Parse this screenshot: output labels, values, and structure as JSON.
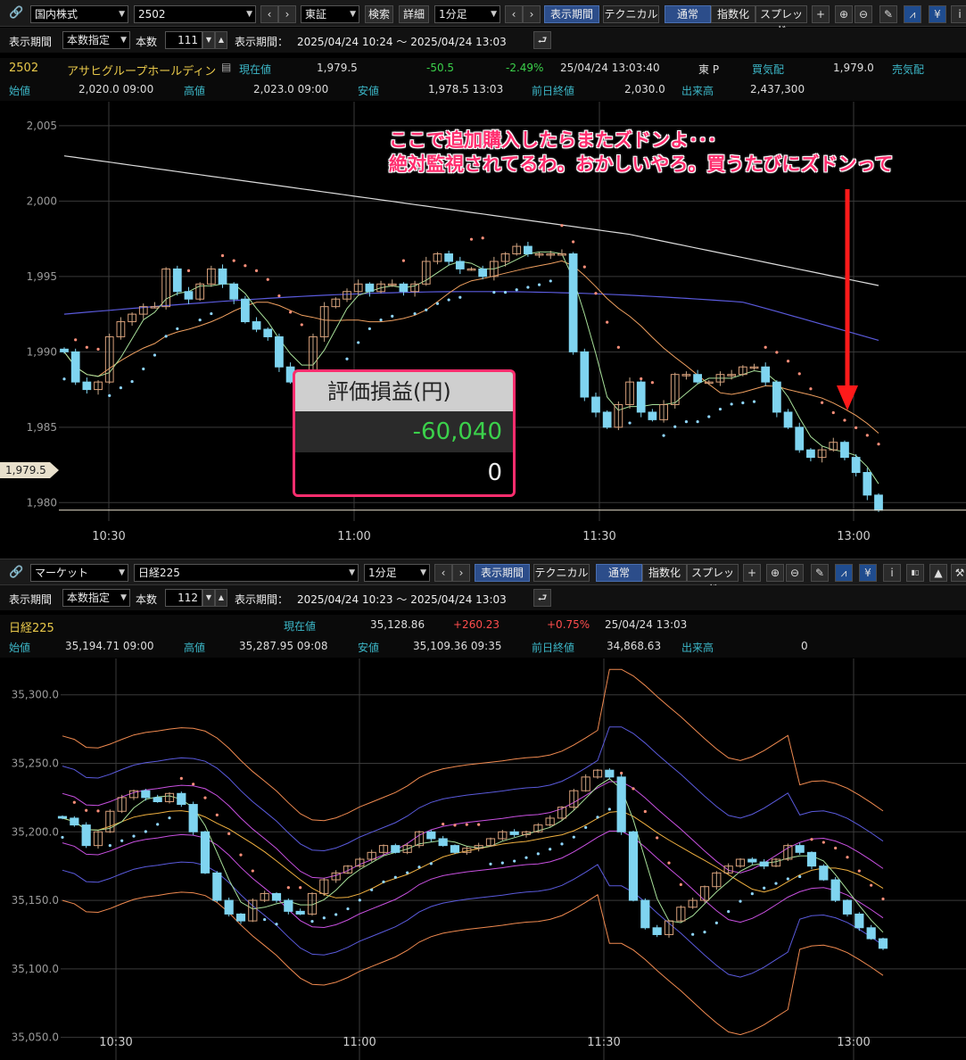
{
  "top": {
    "toolbar": {
      "market_select": "国内株式",
      "code_input": "2502",
      "exchange_select": "東証",
      "search_btn": "検索",
      "detail_btn": "詳細",
      "interval_select": "1分足",
      "period_btn": "表示期間",
      "technical_btn": "テクニカル",
      "normal_btn": "通常",
      "index_btn": "指数化",
      "spread_btn": "スプレッド"
    },
    "row2": {
      "period_label": "表示期間",
      "period_mode": "本数指定",
      "count_label": "本数",
      "count_value": "111",
      "range_label": "表示期間：",
      "range_value": "2025/04/24 10:24 ～ 2025/04/24 13:03"
    },
    "info1": {
      "code": "2502",
      "name": "アサヒグループホールディン",
      "current_label": "現在値",
      "current_value": "1,979.5",
      "change": "-50.5",
      "change_pct": "-2.49%",
      "datetime": "25/04/24  13:03:40",
      "market": "東 P",
      "bid_label": "買気配",
      "bid_value": "1,979.0",
      "ask_label": "売気配"
    },
    "info2": {
      "open_label": "始値",
      "open_value": "2,020.0  09:00",
      "high_label": "高値",
      "high_value": "2,023.0  09:00",
      "low_label": "安値",
      "low_value": "1,978.5  13:03",
      "prev_label": "前日終値",
      "prev_value": "2,030.0",
      "volume_label": "出来高",
      "volume_value": "2,437,300"
    },
    "annotation_line1": "ここで追加購入したらまたズドンよ･･･",
    "annotation_line2": "絶対監視されてるわ。おかしいやろ。買うたびにズドンって",
    "pnl_header": "評価損益(円)",
    "pnl_value": "-60,040",
    "pnl_second": "0",
    "price_tag": "1,979.5"
  },
  "bottom": {
    "toolbar": {
      "market_select": "マーケット",
      "code_input": "日経225",
      "interval_select": "1分足",
      "period_btn": "表示期間",
      "technical_btn": "テクニカル",
      "normal_btn": "通常",
      "index_btn": "指数化",
      "spread_btn": "スプレッド"
    },
    "row2": {
      "period_label": "表示期間",
      "period_mode": "本数指定",
      "count_label": "本数",
      "count_value": "112",
      "range_label": "表示期間：",
      "range_value": "2025/04/24 10:23 ～ 2025/04/24 13:03"
    },
    "info1": {
      "name": "日経225",
      "current_label": "現在値",
      "current_value": "35,128.86",
      "change": "+260.23",
      "change_pct": "+0.75%",
      "datetime": "25/04/24  13:03"
    },
    "info2": {
      "open_label": "始値",
      "open_value": "35,194.71  09:00",
      "high_label": "高値",
      "high_value": "35,287.95  09:08",
      "low_label": "安値",
      "low_value": "35,109.36  09:35",
      "prev_label": "前日終値",
      "prev_value": "34,868.63",
      "volume_label": "出来高",
      "volume_value": "0"
    }
  },
  "chart_data": [
    {
      "type": "candlestick",
      "title": "",
      "ylim": [
        1977,
        2006
      ],
      "yticks": [
        "2,005",
        "2,000",
        "1,995",
        "1,990",
        "1,985",
        "1,980"
      ],
      "xticks": [
        "10:30",
        "11:00",
        "11:30",
        "13:00"
      ],
      "close_path": [
        1990,
        1988,
        1987.5,
        1988,
        1991,
        1992,
        1992.5,
        1993,
        1993,
        1995.5,
        1994,
        1993.5,
        1994.5,
        1995.5,
        1994.5,
        1993.5,
        1992,
        1991.5,
        1991,
        1989,
        1988,
        1988.5,
        1991,
        1993,
        1993.5,
        1994,
        1994.5,
        1994,
        1994.5,
        1994.5,
        1994,
        1994.5,
        1996,
        1996.5,
        1996,
        1995.5,
        1995.5,
        1995,
        1996,
        1996.5,
        1997,
        1996.5,
        1996.5,
        1996.5,
        1996.5,
        1990,
        1987,
        1986,
        1985,
        1986.5,
        1988,
        1986,
        1985.5,
        1986.5,
        1988.5,
        1988.5,
        1988,
        1988,
        1988.5,
        1988.5,
        1989,
        1989,
        1988,
        1986,
        1985,
        1983.5,
        1983,
        1983.5,
        1984,
        1983,
        1982,
        1980.5,
        1979.5
      ],
      "current_price": 1979.5
    },
    {
      "type": "candlestick",
      "title": "",
      "ylim": [
        35040,
        35320
      ],
      "yticks": [
        "35,300.0",
        "35,250.0",
        "35,200.0",
        "35,150.0",
        "35,100.0",
        "35,050.0"
      ],
      "xticks": [
        "10:30",
        "11:00",
        "11:30",
        "13:00"
      ],
      "close_path": [
        35210,
        35205,
        35190,
        35200,
        35215,
        35225,
        35230,
        35225,
        35222,
        35228,
        35220,
        35200,
        35170,
        35150,
        35140,
        35135,
        35150,
        35155,
        35150,
        35142,
        35140,
        35155,
        35165,
        35170,
        35175,
        35180,
        35185,
        35190,
        35185,
        35190,
        35200,
        35195,
        35190,
        35185,
        35188,
        35190,
        35195,
        35200,
        35198,
        35200,
        35205,
        35210,
        35218,
        35230,
        35240,
        35245,
        35240,
        35200,
        35150,
        35130,
        35125,
        35135,
        35145,
        35150,
        35160,
        35170,
        35175,
        35180,
        35178,
        35175,
        35180,
        35190,
        35185,
        35175,
        35165,
        35150,
        35140,
        35130,
        35122,
        35115
      ]
    }
  ]
}
